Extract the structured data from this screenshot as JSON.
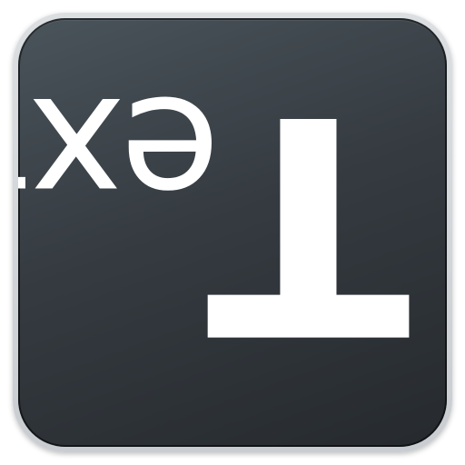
{
  "app_icon": {
    "glyph_first": "T",
    "glyph_rest": "ext",
    "tile_color": "#353b41",
    "text_color": "#ffffff"
  }
}
